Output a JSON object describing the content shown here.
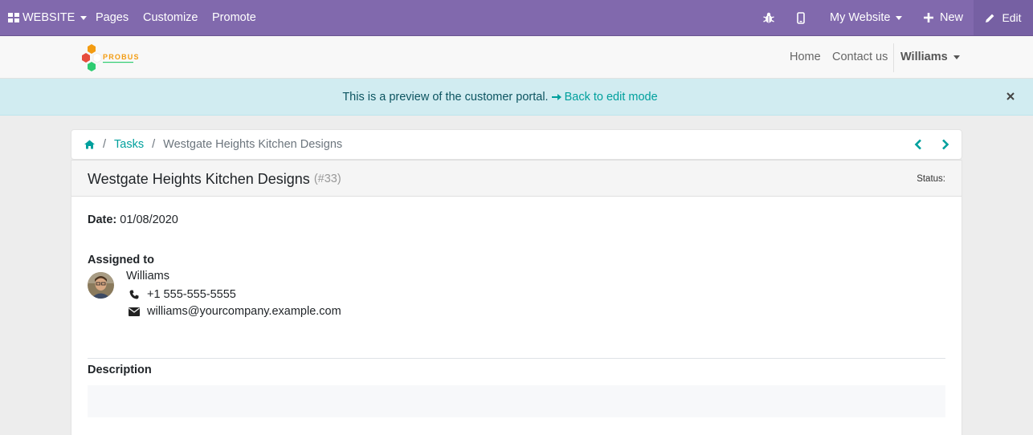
{
  "topbar": {
    "website_label": "WEBSITE",
    "pages_label": "Pages",
    "customize_label": "Customize",
    "promote_label": "Promote",
    "my_website_label": "My Website",
    "new_label": "New",
    "edit_label": "Edit"
  },
  "site_header": {
    "logo_text": "PROBUSE",
    "nav": {
      "home": "Home",
      "contact": "Contact us",
      "user": "Williams"
    }
  },
  "banner": {
    "text": "This is a preview of the customer portal.",
    "link": "Back to edit mode"
  },
  "breadcrumb": {
    "tasks": "Tasks",
    "current": "Westgate Heights Kitchen Designs",
    "separator": "/"
  },
  "task": {
    "title": "Westgate Heights Kitchen Designs",
    "ref": "(#33)",
    "status_label": "Status:",
    "date_label": "Date:",
    "date_value": "01/08/2020",
    "assigned_label": "Assigned to",
    "assignee": {
      "name": "Williams",
      "phone": "+1 555-555-5555",
      "email": "williams@yourcompany.example.com"
    },
    "description_label": "Description"
  },
  "colors": {
    "editor_bar": "#8169ad",
    "accent": "#00a09d",
    "banner_bg": "#d1ecf1",
    "banner_text": "#0c5460"
  }
}
